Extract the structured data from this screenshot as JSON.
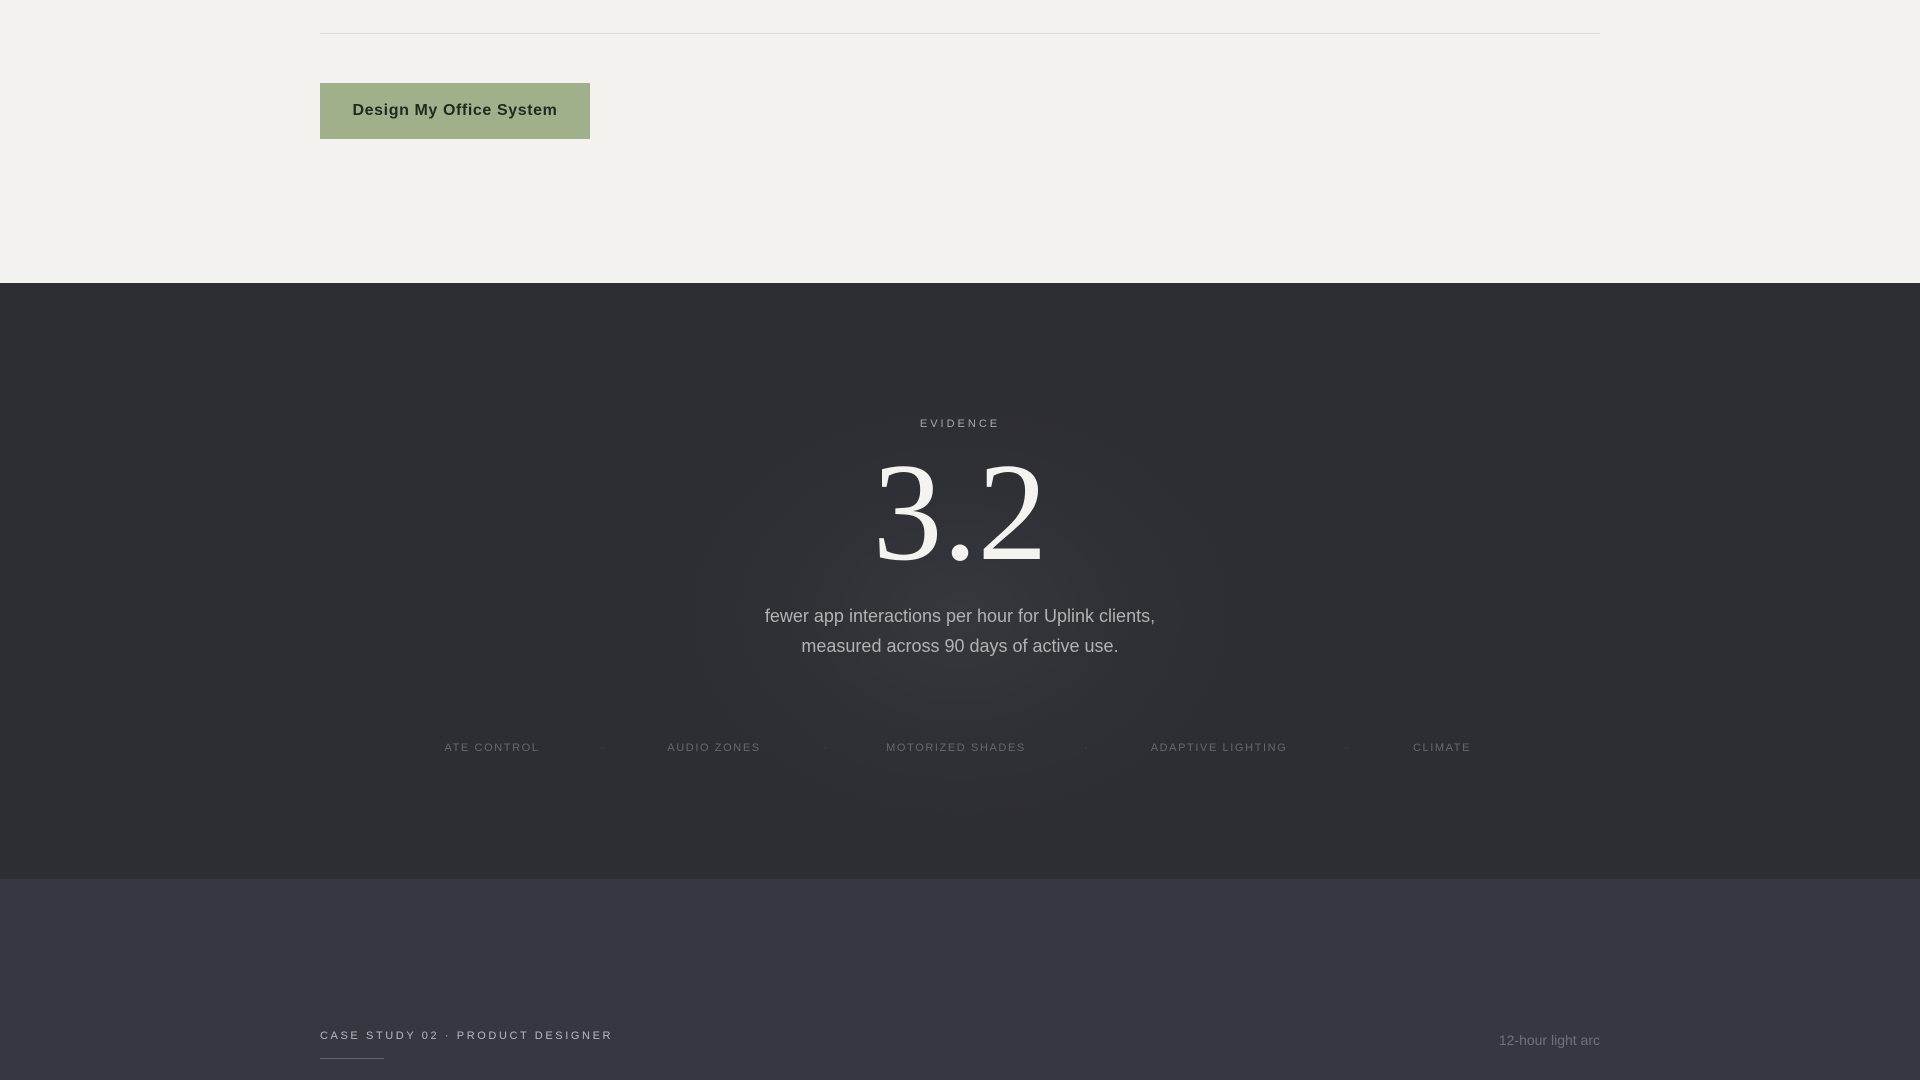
{
  "hero": {
    "cta_label": "Design My Office System"
  },
  "evidence": {
    "eyebrow": "EVIDENCE",
    "stat_value": "3.2",
    "caption_line1": "fewer app interactions per hour for Uplink clients,",
    "caption_line2": "measured across 90 days of active use.",
    "features": [
      "ATE CONTROL",
      "AUDIO ZONES",
      "MOTORIZED SHADES",
      "ADAPTIVE LIGHTING",
      "CLIMATE"
    ],
    "separator": "·"
  },
  "case_study": {
    "label": "CASE STUDY 02 · PRODUCT DESIGNER",
    "note": "12-hour light arc"
  },
  "colors": {
    "light_bg": "#f3f2ee",
    "dark_bg": "#2d2e33",
    "slate_bg": "#353841",
    "accent_green": "#a0b08a"
  }
}
